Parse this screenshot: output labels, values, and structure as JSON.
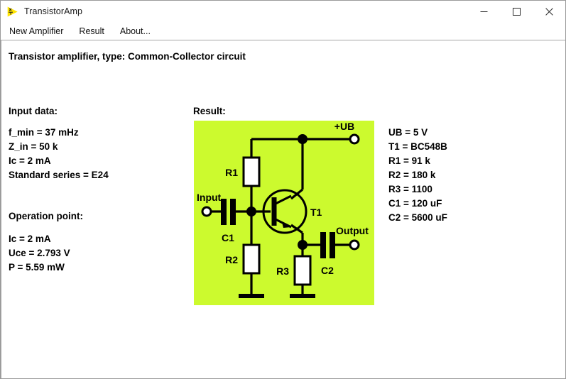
{
  "window": {
    "title": "TransistorAmp",
    "icon": "amplifier-triangle-icon",
    "controls": {
      "minimize": "—",
      "maximize": "□",
      "close": "✕"
    }
  },
  "menu": {
    "items": [
      {
        "label": "New Amplifier",
        "name": "menu-new-amplifier"
      },
      {
        "label": "Result",
        "name": "menu-result"
      },
      {
        "label": "About...",
        "name": "menu-about"
      }
    ]
  },
  "content": {
    "heading": "Transistor amplifier, type: Common-Collector circuit",
    "input_data": {
      "label": "Input data:",
      "lines": [
        "f_min = 37 mHz",
        "Z_in = 50 k",
        "Ic = 2 mA",
        "Standard series = E24"
      ]
    },
    "operation_point": {
      "label": "Operation point:",
      "lines": [
        "Ic = 2 mA",
        "Uce = 2.793 V",
        "P = 5.59 mW"
      ]
    },
    "result": {
      "label": "Result:",
      "lines": [
        "UB = 5 V",
        "T1 = BC548B",
        "R1 = 91 k",
        "R2 = 180 k",
        "R3 = 1100",
        "C1 = 120 uF",
        "C2 = 5600 uF"
      ]
    },
    "schematic": {
      "background_color": "#ccfa2e",
      "stroke_color": "#000000",
      "fill_color": "#ffffff",
      "labels": {
        "supply": "+UB",
        "input": "Input",
        "output": "Output",
        "c1": "C1",
        "c2": "C2",
        "r1": "R1",
        "r2": "R2",
        "r3": "R3",
        "t1": "T1"
      }
    }
  }
}
